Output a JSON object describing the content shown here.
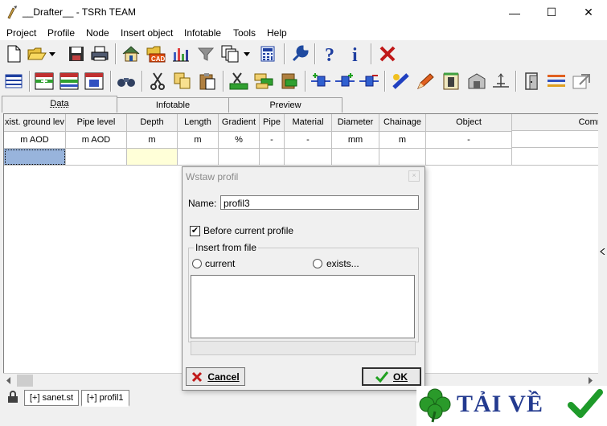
{
  "window": {
    "title": "__Drafter__ - TSRh TEAM",
    "minimize_symbol": "—",
    "maximize_symbol": "☐",
    "close_symbol": "✕"
  },
  "menu": [
    "Project",
    "Profile",
    "Node",
    "Insert object",
    "Infotable",
    "Tools",
    "Help"
  ],
  "tabs": [
    "Data",
    "Infotable",
    "Preview"
  ],
  "grid": {
    "headers": [
      "xist. ground lev",
      "Pipe level",
      "Depth",
      "Length",
      "Gradient",
      "Pipe",
      "Material",
      "Diameter",
      "Chainage",
      "Object",
      "Comm"
    ],
    "units": [
      "m AOD",
      "m AOD",
      "m",
      "m",
      "%",
      "-",
      "-",
      "mm",
      "m",
      "-",
      "-"
    ]
  },
  "bottom_tabs": [
    "[+] sanet.st",
    "[+] profil1"
  ],
  "dialog": {
    "title": "Wstaw profil",
    "name_label": "Name:",
    "name_value": "profil3",
    "before_label": "Before current profile",
    "before_checked": "✔",
    "insert_group_label": "Insert from file",
    "radio_current": "current",
    "radio_exists": "exists...",
    "cancel_label": "Cancel",
    "ok_label": "OK"
  },
  "watermark": {
    "text": "TẢI VỀ"
  },
  "colors": {
    "accent": "#1f3fa0",
    "selection": "#98b4dc",
    "highlight_cell": "#ffffd8",
    "watermark_text": "#233a8f",
    "check_green": "#1e9a2a"
  }
}
